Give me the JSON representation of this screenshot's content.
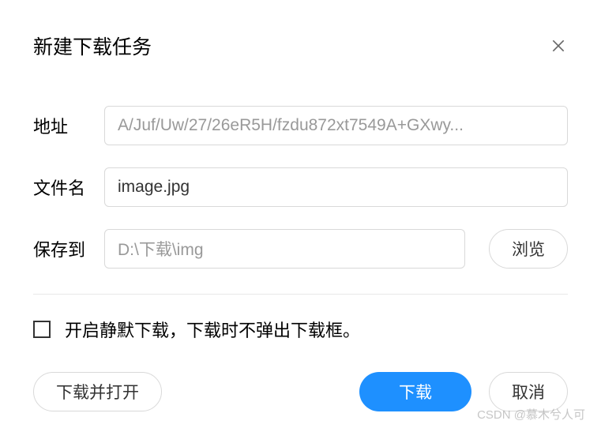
{
  "dialog": {
    "title": "新建下载任务",
    "fields": {
      "url": {
        "label": "地址",
        "value": "A/Juf/Uw/27/26eR5H/fzdu872xt7549A+GXwy..."
      },
      "filename": {
        "label": "文件名",
        "value": "image.jpg"
      },
      "savepath": {
        "label": "保存到",
        "value": "D:\\下载\\img",
        "browse_label": "浏览"
      }
    },
    "silent_download": {
      "label": "开启静默下载，下载时不弹出下载框。",
      "checked": false
    },
    "buttons": {
      "download_open": "下载并打开",
      "download": "下载",
      "cancel": "取消"
    }
  },
  "watermark": "CSDN @慕木兮人可"
}
